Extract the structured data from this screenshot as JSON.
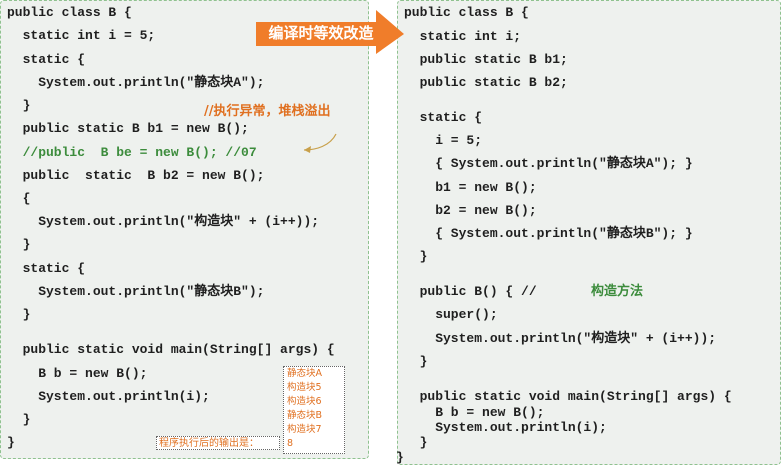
{
  "left": {
    "lines": [
      "public class B {",
      "  static int i = 5;",
      "  static {",
      "    System.out.println(\"静态块A\");",
      "  }",
      "  public static B b1 = new B();",
      "  //public  B be = new B(); //07",
      "  public  static  B b2 = new B();",
      "  {",
      "    System.out.println(\"构造块\" + (i++));",
      "  }",
      "  static {",
      "    System.out.println(\"静态块B\");",
      "  }",
      "  public static void main(String[] args) {",
      "    B b = new B();",
      "    System.out.println(i);",
      "  }",
      "}"
    ]
  },
  "right": {
    "lines": [
      "public class B {",
      "  static int i;",
      "  public static B b1;",
      "  public static B b2;",
      "  static {",
      "    i = 5;",
      "    { System.out.println(\"静态块A\"); }",
      "    b1 = new B();",
      "    b2 = new B();",
      "    { System.out.println(\"静态块B\"); }",
      "  }",
      "  public B() { //",
      "    super();",
      "    System.out.println(\"构造块\" + (i++));",
      "  }",
      "  public static void main(String[] args) {",
      "    B b = new B();",
      "    System.out.println(i);",
      "  }",
      "}"
    ],
    "constructor_comment": "构造方法"
  },
  "callout": {
    "label": "编译时等效改造",
    "color": "#f07d2a"
  },
  "error_note": "//执行异常，堆栈溢出",
  "output": {
    "caption": "程序执行后的输出是：",
    "lines": [
      "静态块A",
      "构造块5",
      "构造块6",
      "静态块B",
      "构造块7",
      "8"
    ]
  },
  "colors": {
    "panel_bg": "#eef1ee",
    "panel_border": "#8fc28f",
    "accent": "#e07020",
    "comment": "#3c8c3c"
  }
}
